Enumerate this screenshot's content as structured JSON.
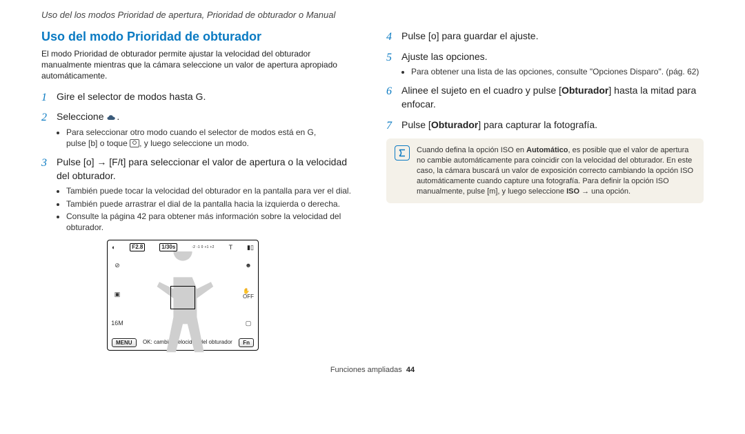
{
  "header": "Uso del los modos Prioridad de apertura, Prioridad de obturador o Manual",
  "section_title": "Uso del modo Prioridad de obturador",
  "intro": "El modo Prioridad de obturador permite ajustar la velocidad del obturador manualmente mientras que la cámara seleccione un valor de apertura apropiado automáticamente.",
  "left_steps": {
    "s1": {
      "text_a": "Gire el selector de modos hasta ",
      "text_b": "G",
      "text_c": "."
    },
    "s2": {
      "text_a": "Seleccione ",
      "text_b": "."
    },
    "s2_sub": {
      "a": "Para seleccionar otro modo cuando el selector de modos está en ",
      "a2": "G",
      "a3": ",",
      "b": "pulse [",
      "b2": "b",
      "b3": "] o toque ",
      "b4": ", y luego seleccione un modo."
    },
    "s3": {
      "a": "Pulse [",
      "a2": "o",
      "a3": "] → [",
      "a4": "F",
      "a5": "/",
      "a6": "t",
      "a7": "] para seleccionar el valor de apertura o la velocidad del obturador."
    },
    "s3_sub": {
      "a": "También puede tocar la velocidad del obturador en la pantalla para ver el dial.",
      "b": "También puede arrastrar el dial de la pantalla hacia la izquierda o derecha.",
      "c": "Consulte la página 42 para obtener más información sobre la velocidad del obturador."
    }
  },
  "right_steps": {
    "s4": {
      "a": "Pulse [",
      "a2": "o",
      "a3": "] para guardar el ajuste."
    },
    "s5": {
      "a": "Ajuste las opciones."
    },
    "s5_sub": {
      "a": "Para obtener una lista de las opciones, consulte \"Opciones Disparo\". (pág. 62)"
    },
    "s6": {
      "a": "Alinee el sujeto en el cuadro y pulse [",
      "b": "Obturador",
      "c": "] hasta la mitad para enfocar."
    },
    "s7": {
      "a": "Pulse [",
      "b": "Obturador",
      "c": "] para capturar la fotografía."
    }
  },
  "note": {
    "a": "Cuando defina la opción ISO en ",
    "b": "Automático",
    "c": ", es posible que el valor de apertura no cambie automáticamente para coincidir con la velocidad del obturador. En este caso, la cámara buscará un valor de exposición correcto cambiando la opción ISO automáticamente cuando capture una fotografía. Para definir la opción ISO manualmente, pulse [",
    "d": "m",
    "e": "], y luego seleccione ",
    "f": "ISO",
    "g": " → una opción."
  },
  "lcd": {
    "aperture": "F2.8",
    "shutter": "1/30s",
    "ev": "-2  -1   0   +1  +2",
    "signal": "T",
    "menu": "MENU",
    "fn": "Fn",
    "caption": "OK: cambiar velocidad del obturador",
    "icons": {
      "cloud": "cloud",
      "flash_off": "⊘",
      "size": "16M",
      "palm_off": "✋",
      "off": "OFF"
    }
  },
  "footer": {
    "section": "Funciones ampliadas",
    "page": "44"
  },
  "chart_data": null
}
